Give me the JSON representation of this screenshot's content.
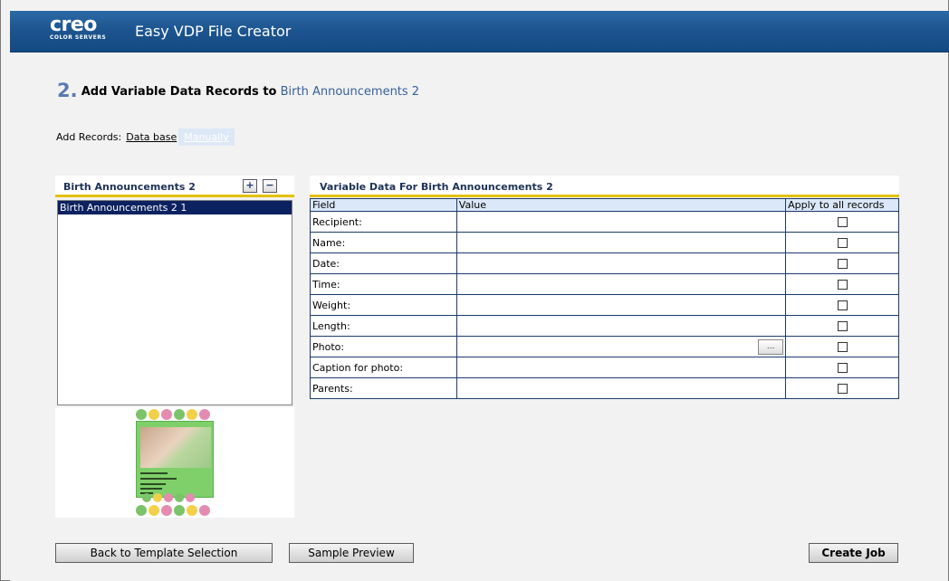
{
  "app": {
    "logo": "creo",
    "logo_sub": "COLOR SERVERS",
    "title": "Easy VDP File Creator"
  },
  "step": {
    "number": "2.",
    "text": "Add Variable Data Records to",
    "template_name": "Birth Announcements 2"
  },
  "add_records": {
    "label": "Add Records:",
    "database_link": "Data base",
    "manually_link": "Manually"
  },
  "records_panel": {
    "title": "Birth Announcements 2",
    "add_button": "+",
    "remove_button": "−",
    "items": [
      "Birth Announcements 2 1"
    ]
  },
  "variable_panel": {
    "title": "Variable Data For Birth Announcements 2",
    "columns": [
      "Field",
      "Value",
      "Apply to all records"
    ],
    "rows": [
      {
        "field": "Recipient:",
        "value": "",
        "apply_all": false
      },
      {
        "field": "Name:",
        "value": "",
        "apply_all": false
      },
      {
        "field": "Date:",
        "value": "",
        "apply_all": false
      },
      {
        "field": "Time:",
        "value": "",
        "apply_all": false
      },
      {
        "field": "Weight:",
        "value": "",
        "apply_all": false
      },
      {
        "field": "Length:",
        "value": "",
        "apply_all": false
      },
      {
        "field": "Photo:",
        "value": "",
        "apply_all": false,
        "browse": "..."
      },
      {
        "field": "Caption for photo:",
        "value": "",
        "apply_all": false
      },
      {
        "field": "Parents:",
        "value": "",
        "apply_all": false
      }
    ]
  },
  "buttons": {
    "back": "Back to Template Selection",
    "preview": "Sample Preview",
    "create": "Create Job"
  },
  "colors": {
    "header": "#1d5590",
    "accent_gold": "#e3c000",
    "selected_row": "#0b2160",
    "table_header": "#dbe8f9"
  },
  "thumbnail": {
    "icon_colors": [
      "#7cc36a",
      "#f3d04a",
      "#e58bb1",
      "#7cc36a",
      "#f3d04a",
      "#e58bb1"
    ]
  }
}
